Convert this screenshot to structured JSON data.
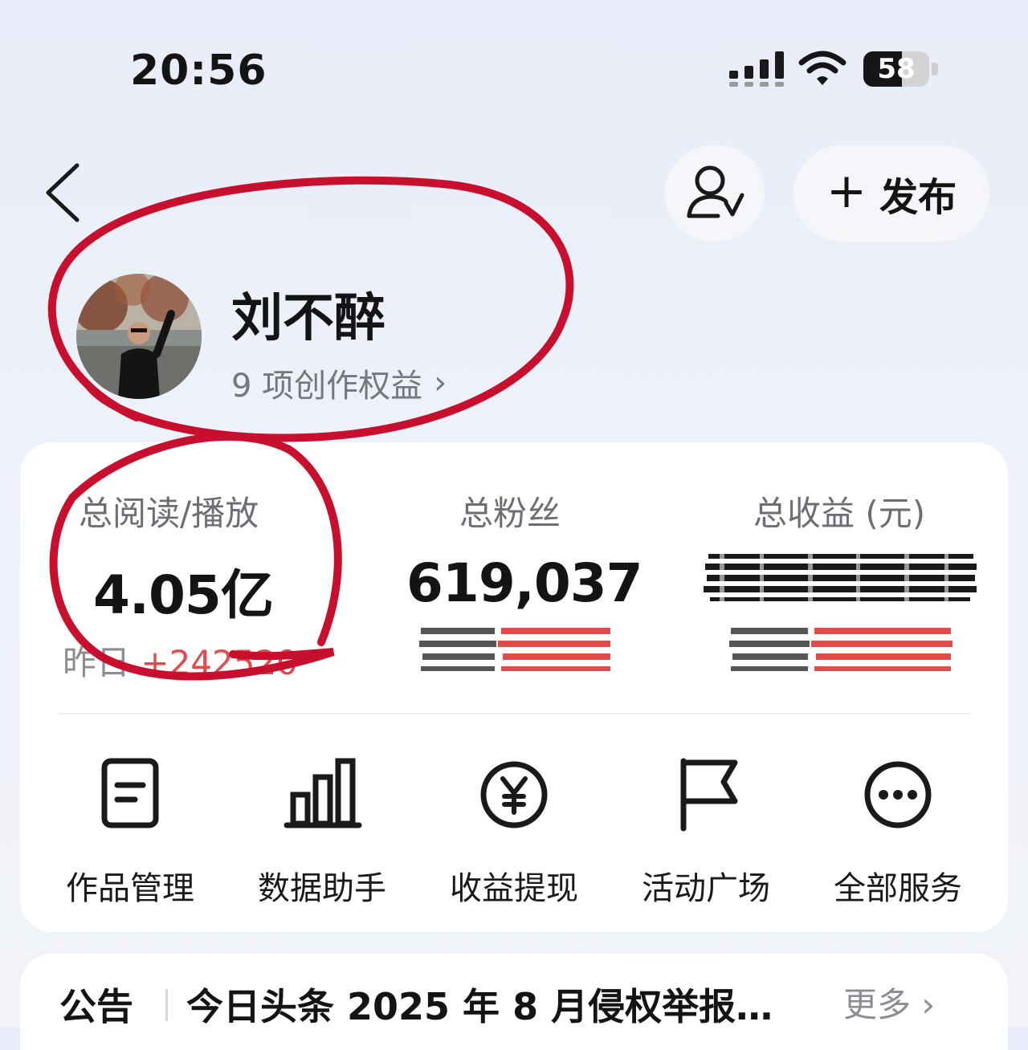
{
  "status_bar": {
    "time": "20:56",
    "battery_level": "58",
    "battery_percent": 58
  },
  "header": {
    "publish_label": "发布",
    "publish_plus": "+"
  },
  "profile": {
    "name": "刘不醉",
    "rights_text": "9 项创作权益",
    "rights_chevron": "›"
  },
  "stats": {
    "reads_label": "总阅读/播放",
    "reads_value": "4.05亿",
    "fans_label": "总粉丝",
    "fans_value": "619,037",
    "earnings_label": "总收益 (元)",
    "yesterday_label": "昨日",
    "yesterday_delta": "+242520"
  },
  "services": [
    {
      "label": "作品管理",
      "icon": "document-icon"
    },
    {
      "label": "数据助手",
      "icon": "bar-chart-icon"
    },
    {
      "label": "收益提现",
      "icon": "yen-coin-icon"
    },
    {
      "label": "活动广场",
      "icon": "flag-icon"
    },
    {
      "label": "全部服务",
      "icon": "more-dots-icon"
    }
  ],
  "notice": {
    "tag": "公告",
    "text": "今日头条 2025 年 8 月侵权举报…",
    "more": "更多 ›"
  },
  "colors": {
    "annotation": "#c8102e",
    "accent_red": "#e24b4b"
  }
}
